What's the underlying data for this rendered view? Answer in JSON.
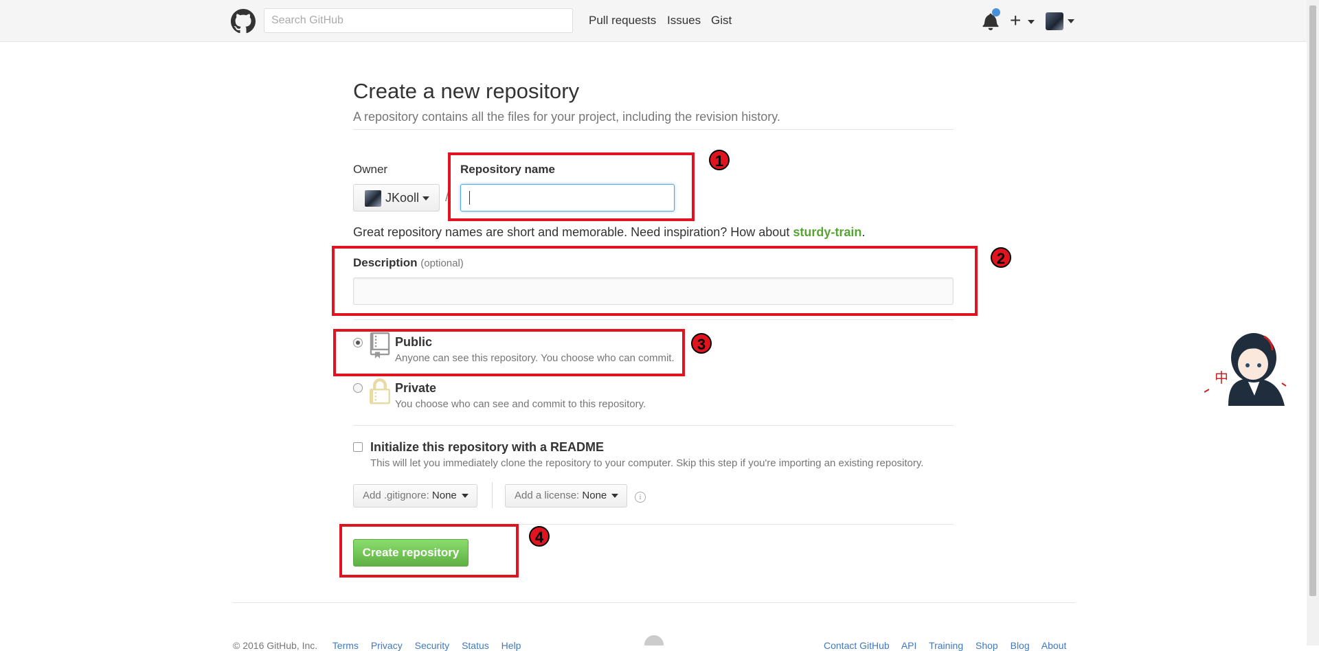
{
  "header": {
    "search_placeholder": "Search GitHub",
    "nav": [
      "Pull requests",
      "Issues",
      "Gist"
    ],
    "plus_label": "+"
  },
  "page": {
    "title": "Create a new repository",
    "subtitle": "A repository contains all the files for your project, including the revision history."
  },
  "form": {
    "owner_label": "Owner",
    "owner_name": "JKooll",
    "separator": "/",
    "repo_name_label": "Repository name",
    "repo_name_value": "",
    "hint_prefix": "Great repository names are short and memorable. Need inspiration? How about ",
    "hint_suggestion": "sturdy-train",
    "hint_suffix": ".",
    "description_label": "Description",
    "description_optional": "(optional)",
    "description_value": "",
    "public_title": "Public",
    "public_desc": "Anyone can see this repository. You choose who can commit.",
    "private_title": "Private",
    "private_desc": "You choose who can see and commit to this repository.",
    "visibility_selected": "Public",
    "readme_label": "Initialize this repository with a README",
    "readme_desc": "This will let you immediately clone the repository to your computer. Skip this step if you're importing an existing repository.",
    "readme_checked": false,
    "gitignore_label": "Add .gitignore:",
    "gitignore_value": "None",
    "license_label": "Add a license:",
    "license_value": "None",
    "info_symbol": "i",
    "create_button": "Create repository"
  },
  "annotations": [
    "1",
    "2",
    "3",
    "4"
  ],
  "mascot_text": "中",
  "footer": {
    "copyright": "© 2016 GitHub, Inc.",
    "left_links": [
      "Terms",
      "Privacy",
      "Security",
      "Status",
      "Help"
    ],
    "right_links": [
      "Contact GitHub",
      "API",
      "Training",
      "Shop",
      "Blog",
      "About"
    ]
  },
  "colors": {
    "annotation_red": "#e0141e",
    "create_green": "#60b044",
    "suggestion_green": "#55a532",
    "link_blue": "#4078c0"
  }
}
